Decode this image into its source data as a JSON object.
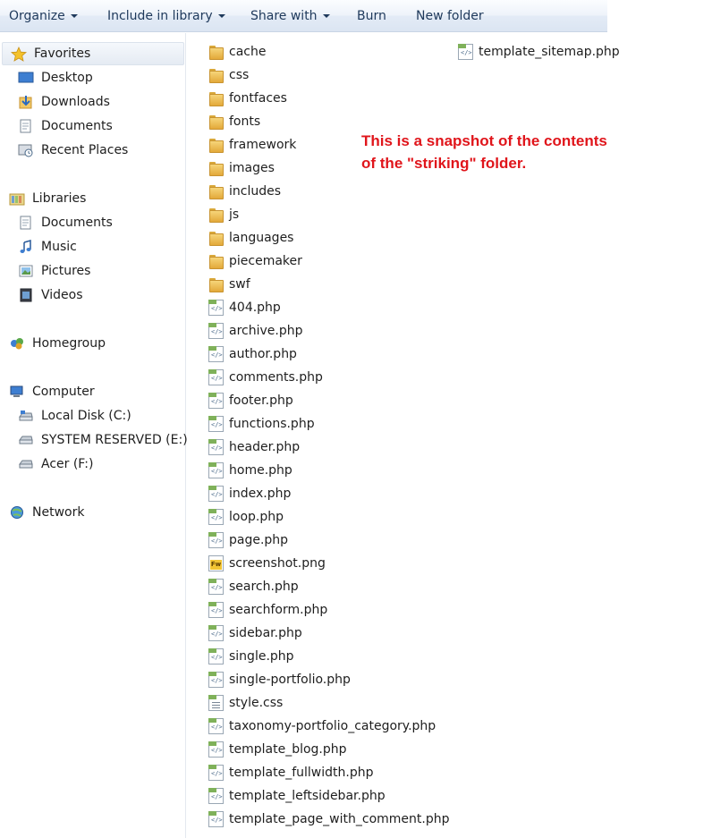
{
  "toolbar": {
    "organize": "Organize",
    "include_in_library": "Include in library",
    "share_with": "Share with",
    "burn": "Burn",
    "new_folder": "New folder"
  },
  "nav": {
    "favorites": "Favorites",
    "desktop": "Desktop",
    "downloads": "Downloads",
    "documents": "Documents",
    "recent_places": "Recent Places",
    "libraries": "Libraries",
    "lib_documents": "Documents",
    "music": "Music",
    "pictures": "Pictures",
    "videos": "Videos",
    "homegroup": "Homegroup",
    "computer": "Computer",
    "local_disk": "Local Disk (C:)",
    "system_reserved": "SYSTEM RESERVED (E:)",
    "acer": "Acer (F:)",
    "network": "Network"
  },
  "files": [
    {
      "name": "cache",
      "type": "folder"
    },
    {
      "name": "css",
      "type": "folder"
    },
    {
      "name": "fontfaces",
      "type": "folder"
    },
    {
      "name": "fonts",
      "type": "folder"
    },
    {
      "name": "framework",
      "type": "folder"
    },
    {
      "name": "images",
      "type": "folder"
    },
    {
      "name": "includes",
      "type": "folder"
    },
    {
      "name": "js",
      "type": "folder"
    },
    {
      "name": "languages",
      "type": "folder"
    },
    {
      "name": "piecemaker",
      "type": "folder"
    },
    {
      "name": "swf",
      "type": "folder"
    },
    {
      "name": "404.php",
      "type": "php"
    },
    {
      "name": "archive.php",
      "type": "php"
    },
    {
      "name": "author.php",
      "type": "php"
    },
    {
      "name": "comments.php",
      "type": "php"
    },
    {
      "name": "footer.php",
      "type": "php"
    },
    {
      "name": "functions.php",
      "type": "php"
    },
    {
      "name": "header.php",
      "type": "php"
    },
    {
      "name": "home.php",
      "type": "php"
    },
    {
      "name": "index.php",
      "type": "php"
    },
    {
      "name": "loop.php",
      "type": "php"
    },
    {
      "name": "page.php",
      "type": "php"
    },
    {
      "name": "screenshot.png",
      "type": "png"
    },
    {
      "name": "search.php",
      "type": "php"
    },
    {
      "name": "searchform.php",
      "type": "php"
    },
    {
      "name": "sidebar.php",
      "type": "php"
    },
    {
      "name": "single.php",
      "type": "php"
    },
    {
      "name": "single-portfolio.php",
      "type": "php"
    },
    {
      "name": "style.css",
      "type": "css"
    },
    {
      "name": "taxonomy-portfolio_category.php",
      "type": "php"
    },
    {
      "name": "template_blog.php",
      "type": "php"
    },
    {
      "name": "template_fullwidth.php",
      "type": "php"
    },
    {
      "name": "template_leftsidebar.php",
      "type": "php"
    },
    {
      "name": "template_page_with_comment.php",
      "type": "php"
    }
  ],
  "files_col2": [
    {
      "name": "template_sitemap.php",
      "type": "php"
    }
  ],
  "annotation": {
    "line1": "This is a snapshot of the contents",
    "line2": "of the \"striking\" folder."
  }
}
